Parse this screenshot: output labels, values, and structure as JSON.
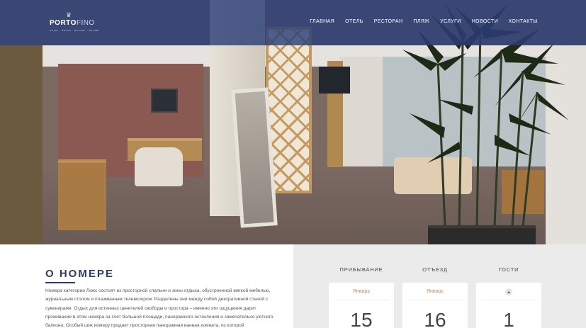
{
  "brand": {
    "name_bold": "PORTO",
    "name_light": "FINO",
    "tagline": "HOTEL · BEACH · RESORT · BATUMI"
  },
  "nav": {
    "items": [
      "ГЛАВНАЯ",
      "ОТЕЛЬ",
      "РЕСТОРАН",
      "ПЛЯЖ",
      "УСЛУГИ",
      "НОВОСТИ",
      "КОНТАКТЫ"
    ]
  },
  "about": {
    "title": "О НОМЕРЕ",
    "lines": [
      "Номера категории Люкс состоят из просторной спальни и зоны отдыха, обустроенной мягкой мебелью,",
      "журнальным столом и плазменным телевизором.  Разделены они между собой декоративной стеной с",
      "сувенирами. Отдых для истинных ценителей свободы и простора – именно эти ощущения дарит",
      "проживание в этом номера за счет большой площади, панорамного остекления и замечательно уютного",
      "балкона. Особый шик номеру придает просторная панорамная   ванная комната, из которой"
    ]
  },
  "booking": {
    "arrival": {
      "label": "ПРИБЫВАНИЕ",
      "month": "Январь",
      "day": "15"
    },
    "departure": {
      "label": "ОТЪЕЗД",
      "month": "Январь",
      "day": "16"
    },
    "guests": {
      "label": "ГОСТИ",
      "count": "1"
    }
  },
  "colors": {
    "header_overlay": "#2c3e78",
    "title_color": "#2d3a6a",
    "month_color": "#c8875a",
    "panel_bg": "#ebebeb"
  },
  "icons": {
    "logo_mark": "crown-icon",
    "guests_control": "chevron-up-icon"
  }
}
